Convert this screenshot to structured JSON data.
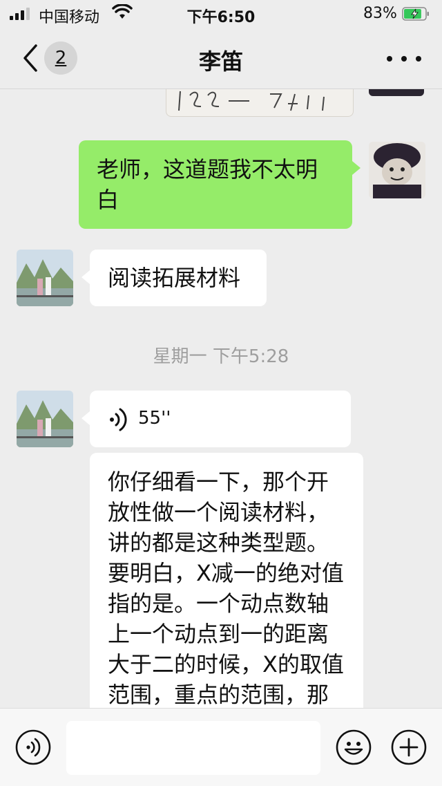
{
  "status_bar": {
    "carrier": "中国移动",
    "time": "下午6:50",
    "battery_percent": "83%",
    "signal_bars": 3,
    "battery_level": 0.83,
    "battery_color": "#34c759"
  },
  "nav": {
    "unread_count": "2",
    "title": "李笛",
    "back_icon": "chevron-left-icon",
    "more_icon": "more-dots-icon"
  },
  "messages": [
    {
      "sender": "self",
      "type": "image-fragment"
    },
    {
      "sender": "self",
      "type": "text",
      "text": "老师，这道题我不太明白"
    },
    {
      "sender": "other",
      "type": "text",
      "text": "阅读拓展材料"
    },
    {
      "type": "time",
      "text": "星期一 下午5:28"
    },
    {
      "sender": "other",
      "type": "voice",
      "duration": "55''"
    },
    {
      "sender": "other",
      "type": "text",
      "text": "你仔细看一下，那个开放性做一个阅读材料，讲的都是这种类型题。要明白，X减一的绝对值指的是。一个动点数轴上一个动点到一的距离大于二的时候，X的取值范围，重点的范围，那要先想X减一等"
    }
  ],
  "input_bar": {
    "voice_button_icon": "voice-mode-icon",
    "emoji_button_icon": "emoji-icon",
    "plus_button_icon": "plus-icon",
    "text_value": ""
  },
  "colors": {
    "background": "#ededed",
    "self_bubble": "#95ec69",
    "other_bubble": "#ffffff",
    "timestamp": "#9e9e9e"
  }
}
